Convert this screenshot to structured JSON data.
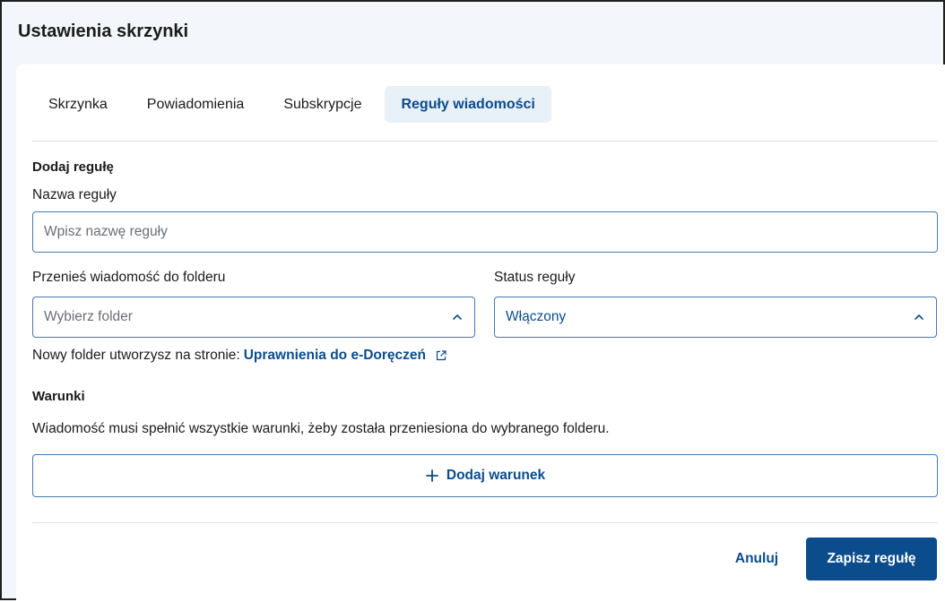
{
  "header": {
    "title": "Ustawienia skrzynki"
  },
  "tabs": [
    {
      "label": "Skrzynka",
      "active": false
    },
    {
      "label": "Powiadomienia",
      "active": false
    },
    {
      "label": "Subskrypcje",
      "active": false
    },
    {
      "label": "Reguły wiadomości",
      "active": true
    }
  ],
  "form": {
    "section_title": "Dodaj regułę",
    "rule_name": {
      "label": "Nazwa reguły",
      "placeholder": "Wpisz nazwę reguły",
      "value": ""
    },
    "folder": {
      "label": "Przenieś wiadomość do folderu",
      "placeholder": "Wybierz folder",
      "icon": "chevron-up-icon"
    },
    "status": {
      "label": "Status reguły",
      "value": "Włączony",
      "icon": "chevron-up-icon"
    },
    "folder_note": {
      "text": "Nowy folder utworzysz na stronie:",
      "link_text": "Uprawnienia do e-Doręczeń",
      "link_icon": "external-link-icon"
    },
    "conditions": {
      "title": "Warunki",
      "description": "Wiadomość musi spełnić wszystkie warunki, żeby została przeniesiona do wybranego folderu.",
      "add_label": "Dodaj warunek",
      "add_icon": "plus-icon"
    }
  },
  "footer": {
    "cancel_label": "Anuluj",
    "save_label": "Zapisz regułę"
  },
  "colors": {
    "accent": "#0b4c8c",
    "active_tab_bg": "#e8f0f8",
    "header_bg": "#f3f6fa",
    "input_border": "#4a78b0"
  }
}
